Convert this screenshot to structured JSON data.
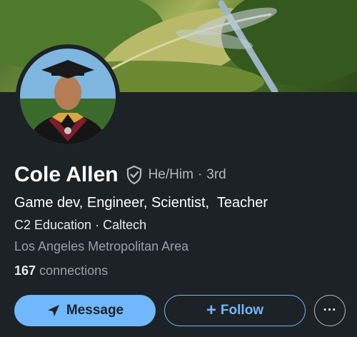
{
  "profile": {
    "name": "Cole Allen",
    "pronouns": "He/Him",
    "separator": "·",
    "degree": "3rd",
    "headline": "Game dev, Engineer, Scientist,  Teacher",
    "company": "C2 Education",
    "school": "Caltech",
    "location": "Los Angeles Metropolitan Area",
    "connections_count": "167",
    "connections_label": "connections"
  },
  "actions": {
    "message_label": "Message",
    "follow_label": "Follow",
    "more_label": "···"
  },
  "icons": {
    "verified": "shield-check-icon",
    "message": "send-icon",
    "follow": "plus-icon",
    "more": "more-horizontal-icon"
  },
  "colors": {
    "background": "#1d2226",
    "accent": "#71b7fb",
    "text_primary": "#ffffff",
    "text_secondary": "#b5b9bd"
  }
}
